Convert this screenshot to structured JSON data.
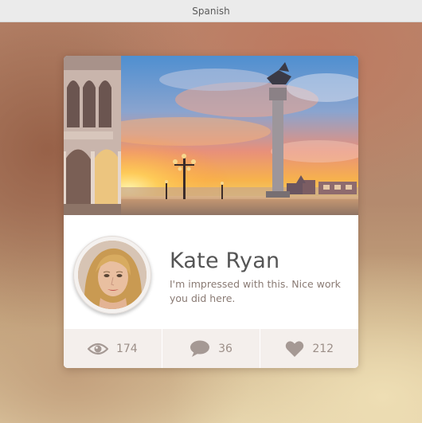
{
  "window": {
    "title": "Spanish"
  },
  "card": {
    "name": "Kate Ryan",
    "comment": "I'm impressed with this. Nice work you did here.",
    "stats": {
      "views": "174",
      "comments": "36",
      "likes": "212"
    }
  },
  "icons": {
    "views": "eye-icon",
    "comments": "speech-bubble-icon",
    "likes": "heart-icon"
  },
  "colors": {
    "name_text": "#555555",
    "comment_text": "#8a7b74",
    "stats_background": "#f4efec",
    "stat_icon": "#a59994"
  }
}
